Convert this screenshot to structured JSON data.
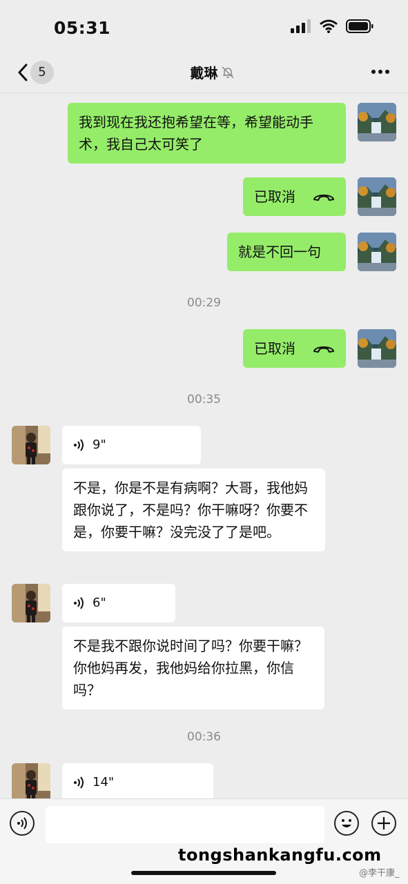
{
  "status": {
    "time": "05:31"
  },
  "header": {
    "back_count": "5",
    "title": "戴琳"
  },
  "messages": {
    "m1": "我到现在我还抱希望在等，希望能动手术，我自己太可笑了",
    "m2": "已取消",
    "m3": "就是不回一句",
    "m4": "已取消",
    "m5_voice": "9\"",
    "m6": "不是，你是不是有病啊？大哥，我他妈跟你说了，不是吗？你干嘛呀？你要不是，你要干嘛？没完没了了是吧。",
    "m7_voice": "6\"",
    "m8": "不是我不跟你说时间了吗？你要干嘛？你他妈再发，我他妈给你拉黑，你信吗？",
    "m9_voice": "14\""
  },
  "timestamps": {
    "t1": "00:29",
    "t2": "00:35",
    "t3": "00:36"
  },
  "watermark": {
    "site": "tongshankangfu.com",
    "weibo": "@李干康_"
  },
  "colors": {
    "self_bubble": "#95ec69",
    "other_bubble": "#ffffff",
    "background": "#ededed"
  }
}
